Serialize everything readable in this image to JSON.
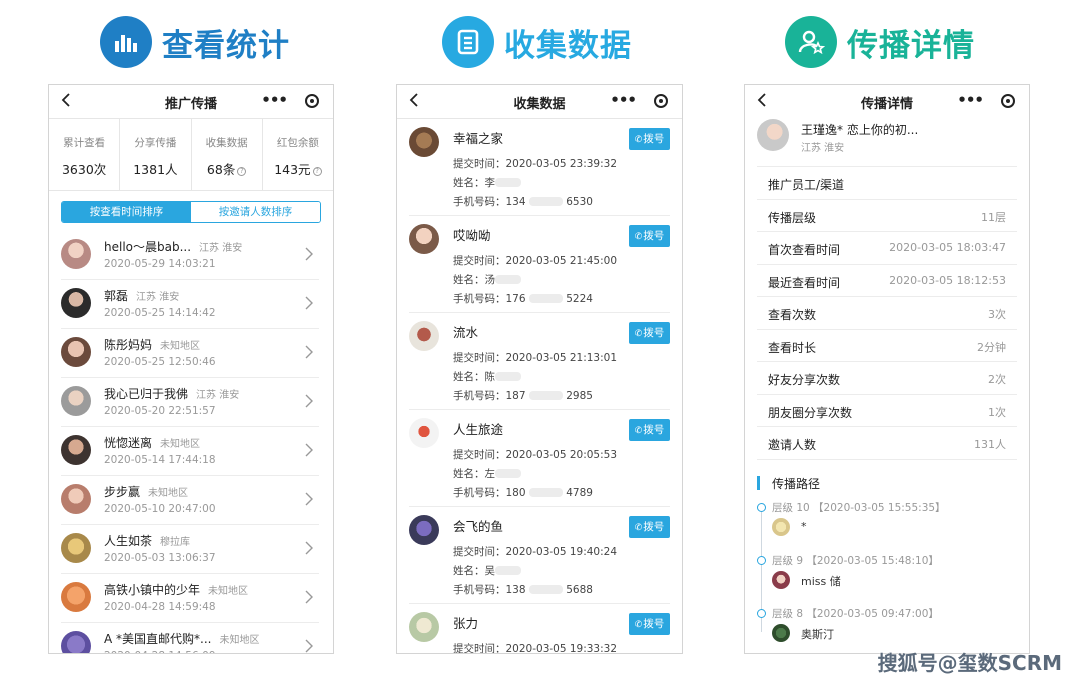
{
  "sections": [
    {
      "title": "查看统计",
      "icon": "bar-chart-icon",
      "color": "#1f7fc5"
    },
    {
      "title": "收集数据",
      "icon": "document-icon",
      "color": "#27a9e1"
    },
    {
      "title": "传播详情",
      "icon": "user-star-icon",
      "color": "#19b398"
    }
  ],
  "phone1": {
    "title": "推广传播",
    "stats": [
      {
        "label": "累计查看",
        "value": "3630次",
        "help": false
      },
      {
        "label": "分享传播",
        "value": "1381人",
        "help": false
      },
      {
        "label": "收集数据",
        "value": "68条",
        "help": true
      },
      {
        "label": "红包余额",
        "value": "143元",
        "help": true
      }
    ],
    "sort_tabs": [
      "按查看时间排序",
      "按邀请人数排序"
    ],
    "help_glyph": "?",
    "users": [
      {
        "name": "hello～晨bab...",
        "loc": "江苏 淮安",
        "time": "2020-05-29 14:03:21"
      },
      {
        "name": "郭磊",
        "loc": "江苏 淮安",
        "time": "2020-05-25 14:14:42"
      },
      {
        "name": "陈彤妈妈",
        "loc": "未知地区",
        "time": "2020-05-25 12:50:46"
      },
      {
        "name": "我心已归于我佛",
        "loc": "江苏 淮安",
        "time": "2020-05-20 22:51:57"
      },
      {
        "name": "恍惚迷离",
        "loc": "未知地区",
        "time": "2020-05-14 17:44:18"
      },
      {
        "name": "步步赢",
        "loc": "未知地区",
        "time": "2020-05-10 20:47:00"
      },
      {
        "name": "人生如茶",
        "loc": "穆拉库",
        "time": "2020-05-03 13:06:37"
      },
      {
        "name": "高铁小镇中的少年",
        "loc": "未知地区",
        "time": "2020-04-28 14:59:48"
      },
      {
        "name": "A *美国直邮代购*...",
        "loc": "未知地区",
        "time": "2020-04-28 14:56:09"
      }
    ]
  },
  "phone2": {
    "title": "收集数据",
    "dial_label": "拨号",
    "dial_glyph": "✆",
    "labels": {
      "time": "提交时间：",
      "name": "姓名：",
      "phone": "手机号码："
    },
    "records": [
      {
        "name": "幸福之家",
        "time": "2020-03-05 23:39:32",
        "surname": "李",
        "phone_prefix": "134",
        "phone_suffix": "6530"
      },
      {
        "name": "哎呦呦",
        "time": "2020-03-05 21:45:00",
        "surname": "汤",
        "phone_prefix": "176",
        "phone_suffix": "5224"
      },
      {
        "name": "流水",
        "time": "2020-03-05 21:13:01",
        "surname": "陈",
        "phone_prefix": "187",
        "phone_suffix": "2985"
      },
      {
        "name": "人生旅途",
        "time": "2020-03-05 20:05:53",
        "surname": "左",
        "phone_prefix": "180",
        "phone_suffix": "4789"
      },
      {
        "name": "会飞的鱼",
        "time": "2020-03-05 19:40:24",
        "surname": "吴",
        "phone_prefix": "138",
        "phone_suffix": "5688"
      },
      {
        "name": "张力",
        "time": "2020-03-05 19:33:32",
        "surname": "",
        "phone_prefix": "",
        "phone_suffix": ""
      }
    ]
  },
  "phone3": {
    "title": "传播详情",
    "user": {
      "name": "王瑾逸* 恋上你的初...",
      "loc": "江苏 淮安"
    },
    "rows": [
      {
        "k": "推广员工/渠道",
        "v": ""
      },
      {
        "k": "传播层级",
        "v": "11层"
      },
      {
        "k": "首次查看时间",
        "v": "2020-03-05 18:03:47"
      },
      {
        "k": "最近查看时间",
        "v": "2020-03-05 18:12:53"
      },
      {
        "k": "查看次数",
        "v": "3次"
      },
      {
        "k": "查看时长",
        "v": "2分钟"
      },
      {
        "k": "好友分享次数",
        "v": "2次"
      },
      {
        "k": "朋友圈分享次数",
        "v": "1次"
      },
      {
        "k": "邀请人数",
        "v": "131人"
      }
    ],
    "path_title": "传播路径",
    "path": [
      {
        "meta": "层级 10 【2020-03-05 15:55:35】",
        "user": "*"
      },
      {
        "meta": "层级 9 【2020-03-05 15:48:10】",
        "user": "miss 储"
      },
      {
        "meta": "层级 8 【2020-03-05 09:47:00】",
        "user": "奥斯汀"
      }
    ]
  },
  "watermark": "搜狐号@玺数SCRM"
}
